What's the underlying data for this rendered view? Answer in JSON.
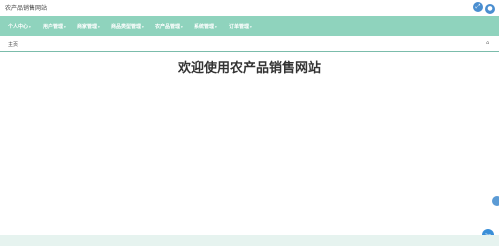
{
  "header": {
    "title": "农产品销售网站",
    "actions": [
      {
        "icon": "expand-icon",
        "glyph": "⤢"
      },
      {
        "icon": "user-icon",
        "glyph": "●"
      }
    ]
  },
  "nav": {
    "items": [
      {
        "label": "个人中心"
      },
      {
        "label": "用户管理"
      },
      {
        "label": "商家管理"
      },
      {
        "label": "商品类型管理"
      },
      {
        "label": "农产品管理"
      },
      {
        "label": "系统管理"
      },
      {
        "label": "订单管理"
      }
    ],
    "caret": "▾"
  },
  "breadcrumb": {
    "label": "主页",
    "icon": "home-icon"
  },
  "main": {
    "welcome_text": "欢迎使用农产品销售网站"
  },
  "floating": {
    "top_button_label": "Top"
  },
  "colors": {
    "nav_bg": "#8fd3bd",
    "accent": "#4a8ed0",
    "footer_bg": "#e6f3ef"
  }
}
